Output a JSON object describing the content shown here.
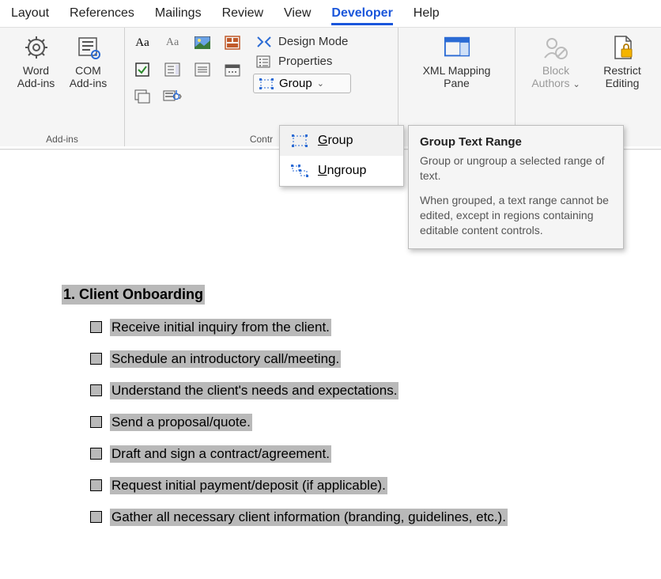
{
  "tabs": {
    "layout": "Layout",
    "references": "References",
    "mailings": "Mailings",
    "review": "Review",
    "view": "View",
    "developer": "Developer",
    "help": "Help"
  },
  "ribbon": {
    "addins_group_label": "Add-ins",
    "word_addins_l1": "Word",
    "word_addins_l2": "Add-ins",
    "com_addins_l1": "COM",
    "com_addins_l2": "Add-ins",
    "controls_group_label": "Contr",
    "design_mode": "Design Mode",
    "properties": "Properties",
    "group": "Group",
    "xml_mapping_l1": "XML Mapping",
    "xml_mapping_l2": "Pane",
    "block_authors_l1": "Block",
    "block_authors_l2": "Authors",
    "restrict_l1": "Restrict",
    "restrict_l2": "Editing"
  },
  "flyout": {
    "group": "Group",
    "ungroup": "Ungroup"
  },
  "tooltip": {
    "title": "Group Text Range",
    "p1": "Group or ungroup a selected range of text.",
    "p2": "When grouped, a text range cannot be edited, except in regions containing editable content controls."
  },
  "doc": {
    "heading": "1. Client Onboarding",
    "items": [
      " Receive initial inquiry from the client.",
      " Schedule an introductory call/meeting.",
      " Understand the client's needs and expectations.",
      "Send a proposal/quote.",
      "Draft and sign a contract/agreement.",
      "Request initial payment/deposit (if applicable).",
      "Gather all necessary client information (branding, guidelines, etc.)."
    ]
  }
}
